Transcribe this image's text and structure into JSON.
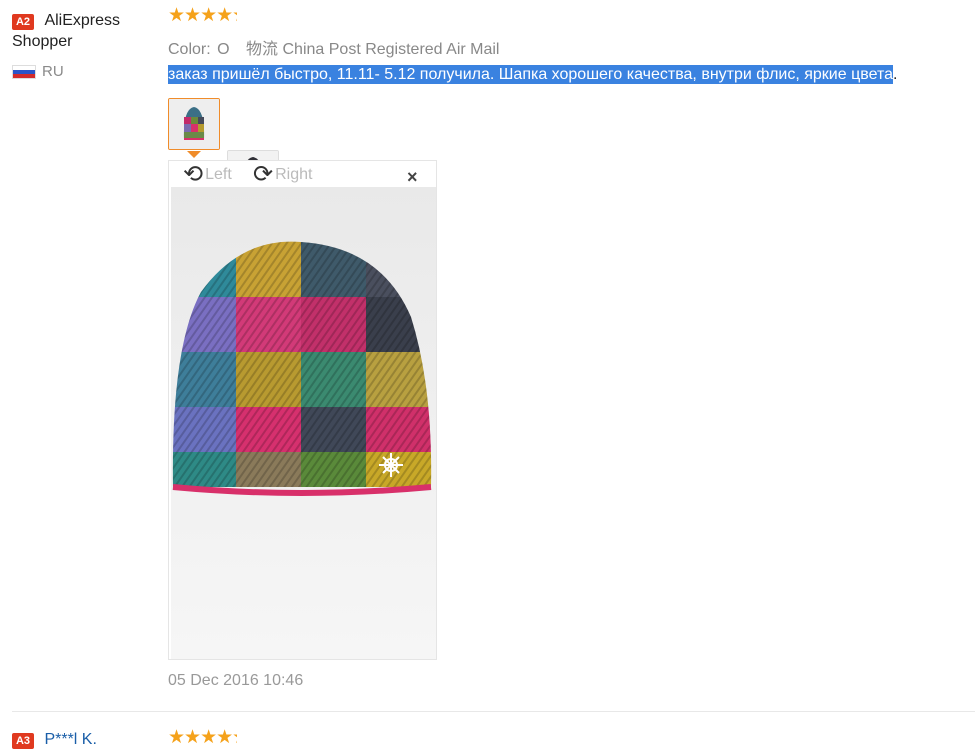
{
  "review1": {
    "badge": "A2",
    "name_line1": "AliExpress",
    "name_line2": "Shopper",
    "country": "RU",
    "flag_icon": "russia-flag-icon",
    "rating": 4.5,
    "stars_text": "★★★★",
    "meta_label": "Color:",
    "meta_value": "O",
    "shipping": "物流 China Post Registered Air Mail",
    "text_selected": "заказ пришёл быстро, 11.11- 5.12 получила. Шапка хорошего качества, внутри флис, яркие цвета",
    "text_tail": ".",
    "rotate_left": "Left",
    "rotate_right": "Right",
    "close_icon": "×",
    "date": "05 Dec 2016 10:46"
  },
  "review2": {
    "badge": "A3",
    "name": "P***l K.",
    "rating": 4.5,
    "stars_text": "★★★★"
  },
  "colors": {
    "accent_orange": "#f08c2a",
    "badge_red": "#e0391f",
    "star": "#f5a21b",
    "selection": "#3a82e0",
    "link_blue": "#1a5ea8"
  }
}
